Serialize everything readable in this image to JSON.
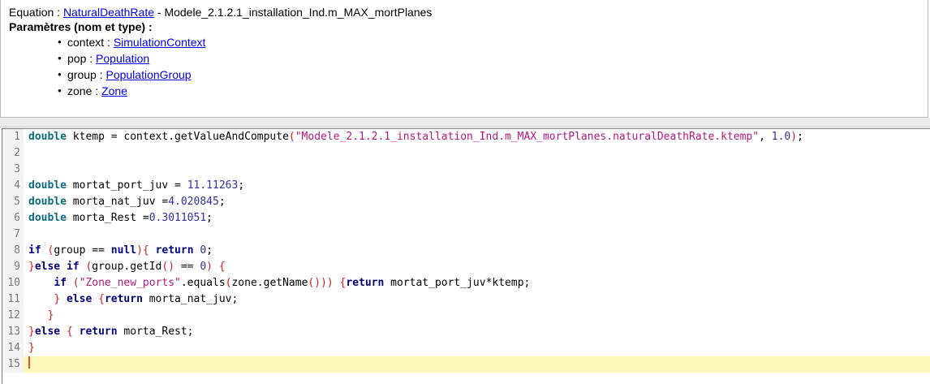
{
  "equation": {
    "label": "Equation : ",
    "name": "NaturalDeathRate",
    "suffix": " - Modele_2.1.2.1_installation_Ind.m_MAX_mortPlanes"
  },
  "params_title": "Paramètres (nom et type) :",
  "params": [
    {
      "name": "context",
      "type": "SimulationContext"
    },
    {
      "name": "pop",
      "type": "Population"
    },
    {
      "name": "group",
      "type": "PopulationGroup"
    },
    {
      "name": "zone",
      "type": "Zone"
    }
  ],
  "code_lines": [
    "double ktemp = context.getValueAndCompute(\"Modele_2.1.2.1_installation_Ind.m_MAX_mortPlanes.naturalDeathRate.ktemp\", 1.0);",
    "",
    "",
    "double mortat_port_juv = 11.11263;",
    "double morta_nat_juv =4.020845;",
    "double morta_Rest =0.3011051;",
    "",
    "if (group == null){ return 0;",
    "}else if (group.getId() == 0) {",
    "    if (\"Zone_new_ports\".equals(zone.getName())) {return mortat_port_juv*ktemp;",
    "    } else {return morta_nat_juv;",
    "   }",
    "}else { return morta_Rest;",
    "}",
    ""
  ],
  "current_line": 15
}
